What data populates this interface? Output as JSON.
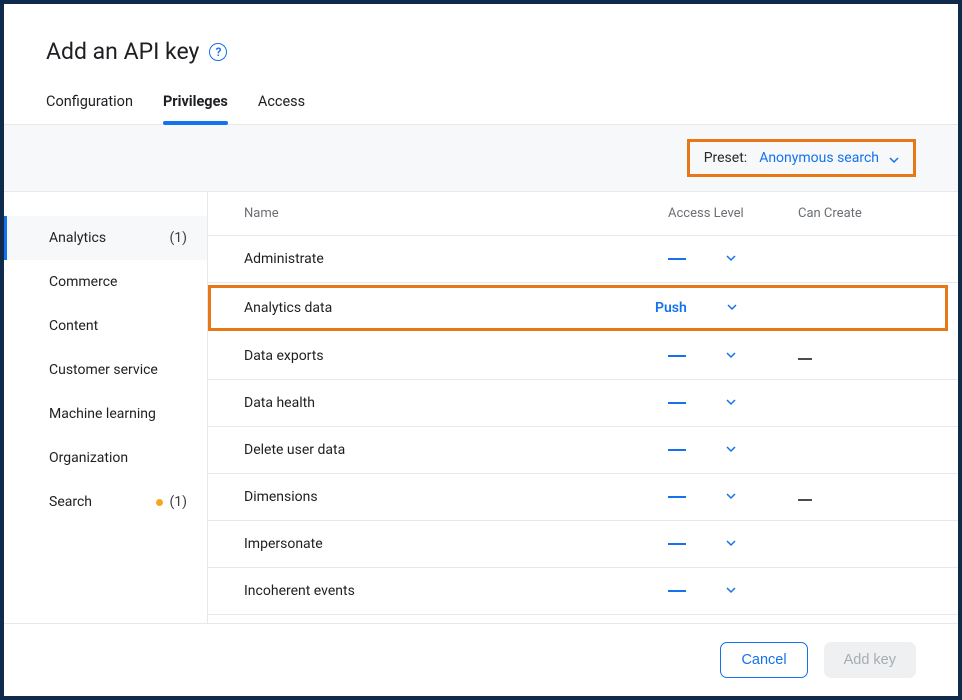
{
  "title": "Add an API key",
  "tabs": [
    {
      "label": "Configuration",
      "active": false
    },
    {
      "label": "Privileges",
      "active": true
    },
    {
      "label": "Access",
      "active": false
    }
  ],
  "preset": {
    "label": "Preset:",
    "value": "Anonymous search"
  },
  "sidebar": [
    {
      "label": "Analytics",
      "count": "(1)",
      "active": true,
      "dot": false
    },
    {
      "label": "Commerce",
      "count": "",
      "active": false,
      "dot": false
    },
    {
      "label": "Content",
      "count": "",
      "active": false,
      "dot": false
    },
    {
      "label": "Customer service",
      "count": "",
      "active": false,
      "dot": false
    },
    {
      "label": "Machine learning",
      "count": "",
      "active": false,
      "dot": false
    },
    {
      "label": "Organization",
      "count": "",
      "active": false,
      "dot": false
    },
    {
      "label": "Search",
      "count": "(1)",
      "active": false,
      "dot": true
    }
  ],
  "table": {
    "headers": {
      "name": "Name",
      "access_level": "Access Level",
      "can_create": "Can Create"
    },
    "rows": [
      {
        "name": "Administrate",
        "access": "dash",
        "can_create": "",
        "highlight": false
      },
      {
        "name": "Analytics data",
        "access": "Push",
        "can_create": "",
        "highlight": true
      },
      {
        "name": "Data exports",
        "access": "dash",
        "can_create": "dash",
        "highlight": false
      },
      {
        "name": "Data health",
        "access": "dash",
        "can_create": "",
        "highlight": false
      },
      {
        "name": "Delete user data",
        "access": "dash",
        "can_create": "",
        "highlight": false
      },
      {
        "name": "Dimensions",
        "access": "dash",
        "can_create": "dash",
        "highlight": false
      },
      {
        "name": "Impersonate",
        "access": "dash",
        "can_create": "",
        "highlight": false
      },
      {
        "name": "Incoherent events",
        "access": "dash",
        "can_create": "",
        "highlight": false
      }
    ]
  },
  "footer": {
    "cancel": "Cancel",
    "add": "Add key"
  }
}
